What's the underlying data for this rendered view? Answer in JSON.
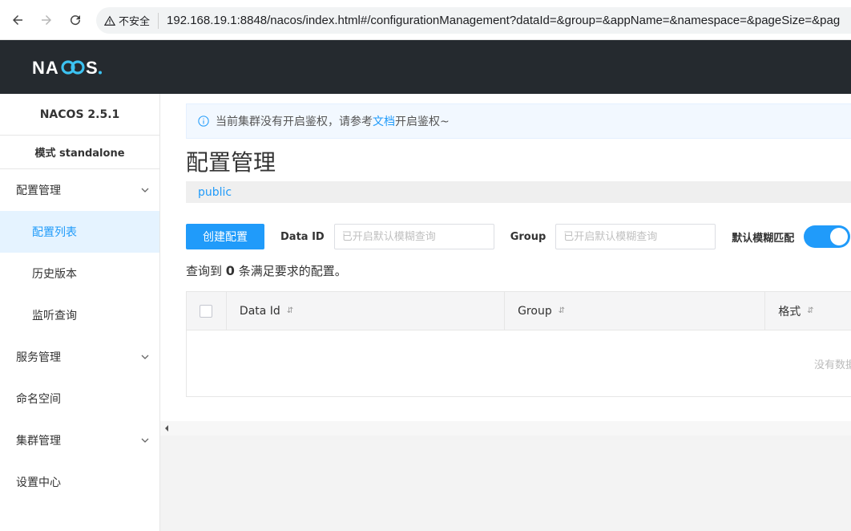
{
  "browser": {
    "security_label": "不安全",
    "url": "192.168.19.1:8848/nacos/index.html#/configurationManagement?dataId=&group=&appName=&namespace=&pageSize=&pag"
  },
  "header": {
    "logo_text": "NACOS."
  },
  "sidebar": {
    "version": "NACOS 2.5.1",
    "mode": "模式 standalone",
    "items": [
      {
        "label": "配置管理",
        "expandable": true
      },
      {
        "label": "配置列表",
        "active": true
      },
      {
        "label": "历史版本"
      },
      {
        "label": "监听查询"
      },
      {
        "label": "服务管理",
        "expandable": true
      },
      {
        "label": "命名空间"
      },
      {
        "label": "集群管理",
        "expandable": true
      },
      {
        "label": "设置中心"
      }
    ]
  },
  "notice": {
    "prefix": "当前集群没有开启鉴权，请参考",
    "link": "文档",
    "suffix": "开启鉴权~"
  },
  "page": {
    "title": "配置管理",
    "namespace": "public"
  },
  "toolbar": {
    "create_label": "创建配置",
    "dataid_label": "Data ID",
    "dataid_placeholder": "已开启默认模糊查询",
    "group_label": "Group",
    "group_placeholder": "已开启默认模糊查询",
    "fuzzy_label": "默认模糊匹配",
    "fuzzy_on": true
  },
  "query": {
    "prefix": "查询到",
    "count": "0",
    "suffix": "条满足要求的配置。"
  },
  "table": {
    "columns": [
      "Data Id",
      "Group",
      "格式"
    ],
    "sort_icon": "⇵",
    "empty_text": "没有数据"
  },
  "colors": {
    "accent": "#209bfa",
    "header_bg": "#252a2f"
  }
}
